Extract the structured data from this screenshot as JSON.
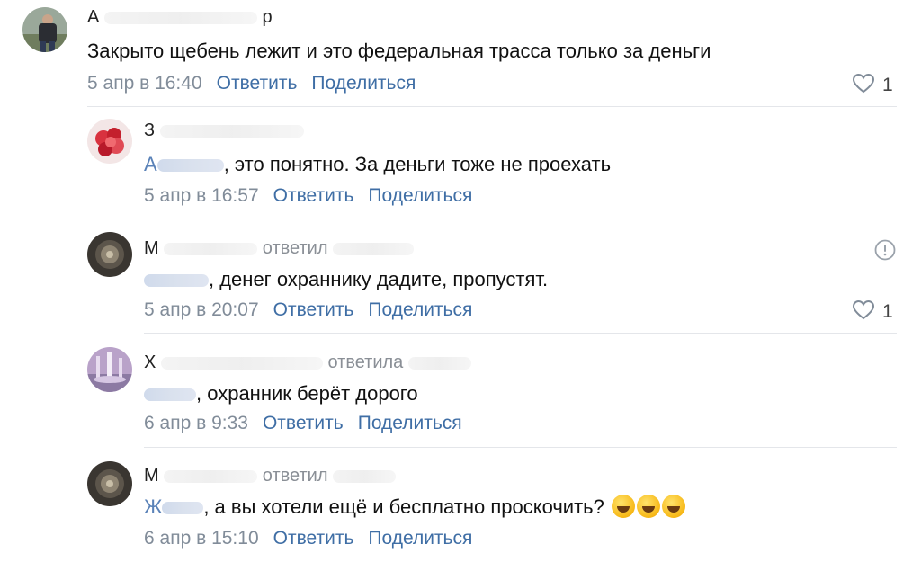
{
  "comments": [
    {
      "author_prefix": "А",
      "author_suffix": "р",
      "replied": "",
      "mention": "",
      "text": "Закрыто щебень лежит и это федеральная трасса только за деньги",
      "date": "5 апр в 16:40",
      "reply_label": "Ответить",
      "share_label": "Поделиться",
      "likes": "1"
    },
    {
      "author_prefix": "З",
      "author_suffix": "",
      "replied": "",
      "mention": "А",
      "text": ", это понятно. За деньги тоже не проехать",
      "date": "5 апр в 16:57",
      "reply_label": "Ответить",
      "share_label": "Поделиться",
      "likes": ""
    },
    {
      "author_prefix": "М",
      "author_suffix": "",
      "replied": "ответил",
      "mention": "",
      "text": ", денег охраннику дадите, пропустят.",
      "date": "5 апр в 20:07",
      "reply_label": "Ответить",
      "share_label": "Поделиться",
      "likes": "1"
    },
    {
      "author_prefix": "Х",
      "author_suffix": "",
      "replied": "ответила",
      "mention": "",
      "text": ", охранник берёт дорого",
      "date": "6 апр в 9:33",
      "reply_label": "Ответить",
      "share_label": "Поделиться",
      "likes": ""
    },
    {
      "author_prefix": "М",
      "author_suffix": "",
      "replied": "ответил",
      "mention": "Ж",
      "text": ", а вы хотели ещё и бесплатно проскочить?",
      "date": "6 апр в 15:10",
      "reply_label": "Ответить",
      "share_label": "Поделиться",
      "likes": ""
    }
  ],
  "colors": {
    "link": "#3f6ea5",
    "meta": "#818c99",
    "mention": "#5a82b8",
    "divider": "#e4e6ea"
  },
  "icons": [
    "heart-icon",
    "report-icon",
    "rofl-emoji-icon"
  ]
}
